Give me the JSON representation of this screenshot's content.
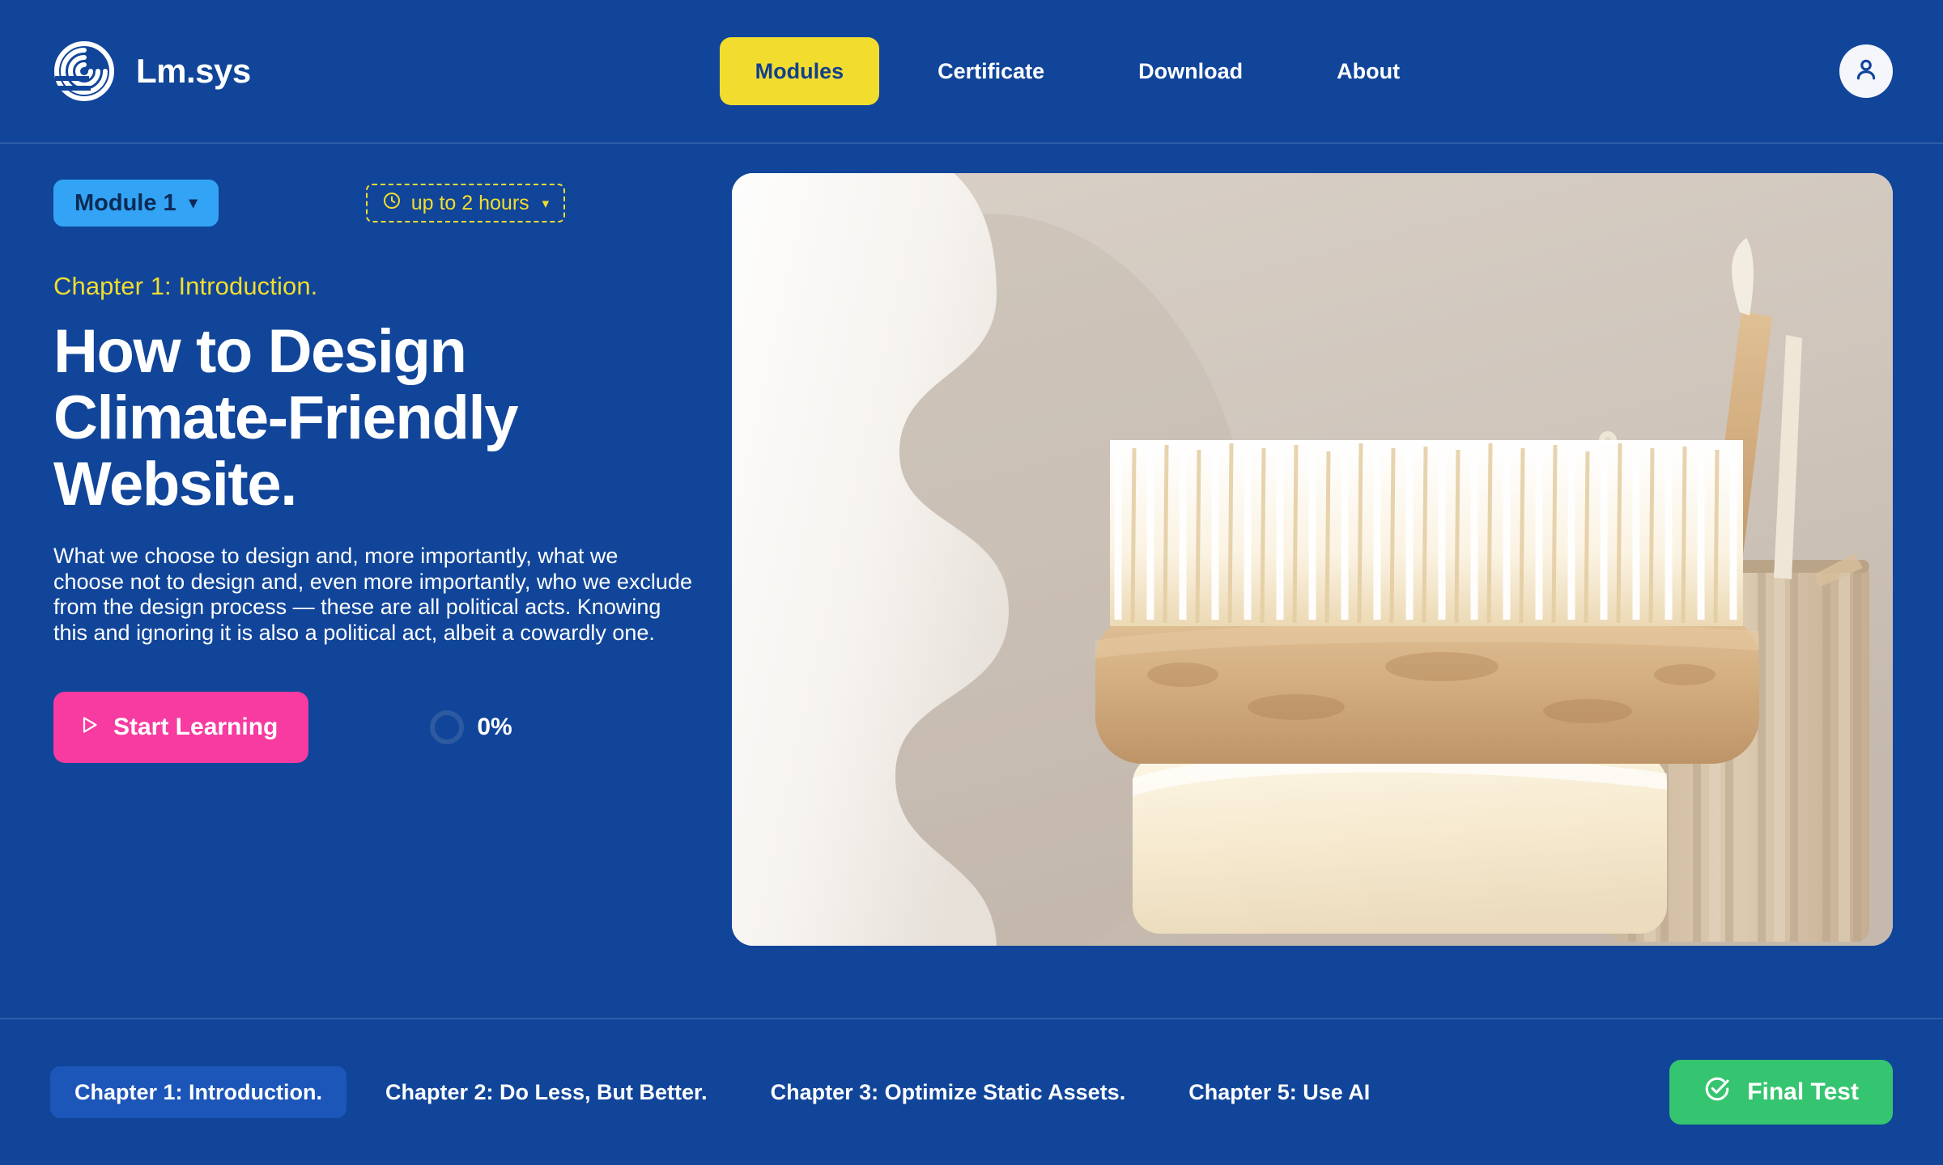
{
  "brand": {
    "name": "Lm.sys",
    "logo_icon": "spiral-logo-icon"
  },
  "nav": {
    "items": [
      {
        "label": "Modules",
        "active": true
      },
      {
        "label": "Certificate",
        "active": false
      },
      {
        "label": "Download",
        "active": false
      },
      {
        "label": "About",
        "active": false
      }
    ],
    "avatar_icon": "user-avatar-icon"
  },
  "hero": {
    "module_selector": {
      "label": "Module 1",
      "caret": "▾"
    },
    "duration_selector": {
      "icon": "clock-icon",
      "label": "up to 2 hours",
      "caret": "▾"
    },
    "eyebrow": "Chapter 1: Introduction.",
    "headline": "How to Design Climate-Friendly Website.",
    "blurb": "What we choose to design and, more importantly, what we choose not to design and, even more importantly, who we exclude from the design process — these are all political acts. Knowing this and ignoring it is also a political act, albeit a cowardly one.",
    "start_button": {
      "label": "Start Learning",
      "icon": "play-icon"
    },
    "progress": {
      "value": "0%"
    },
    "image_alt": "White wavy sculpture, wooden nail brush on soap bar, and fluted cup with bamboo toothbrushes"
  },
  "bottom_bar": {
    "chapters": [
      {
        "label": "Chapter 1: Introduction.",
        "active": true
      },
      {
        "label": "Chapter 2: Do Less, But Better.",
        "active": false
      },
      {
        "label": "Chapter 3: Optimize Static Assets.",
        "active": false
      },
      {
        "label": "Chapter 5: Use AI",
        "active": false
      }
    ],
    "final_test": {
      "label": "Final Test",
      "icon": "check-circle-icon"
    }
  },
  "colors": {
    "background": "#10459a",
    "accent_yellow": "#f2dd2e",
    "accent_pink": "#f73ba0",
    "accent_green": "#35c46f",
    "accent_lightblue": "#33a3f5"
  }
}
